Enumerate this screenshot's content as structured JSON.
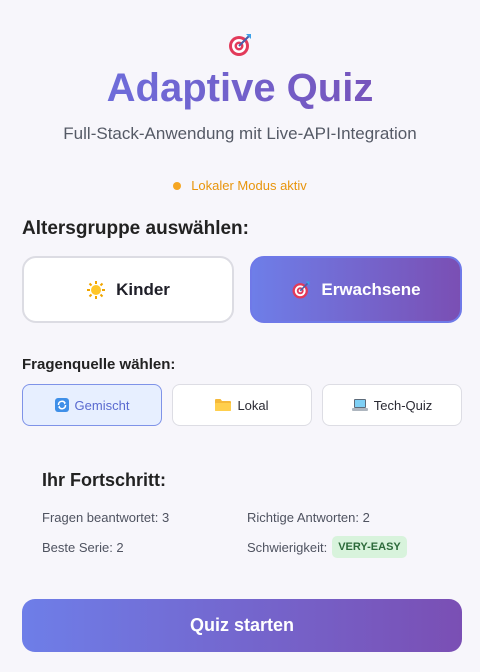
{
  "app": {
    "title": "Adaptive Quiz",
    "subtitle": "Full-Stack-Anwendung mit Live-API-Integration",
    "logo_icon": "target-icon",
    "mode_status": "Lokaler Modus aktiv",
    "mode_status_color": "#f5a623"
  },
  "age_group": {
    "heading": "Altersgruppe auswählen:",
    "options": [
      {
        "label": "Kinder",
        "icon": "sun-icon",
        "selected": false
      },
      {
        "label": "Erwachsene",
        "icon": "target-icon",
        "selected": true
      }
    ]
  },
  "source": {
    "heading": "Fragenquelle wählen:",
    "options": [
      {
        "label": "Gemischt",
        "icon": "shuffle-icon",
        "selected": true
      },
      {
        "label": "Lokal",
        "icon": "folder-icon",
        "selected": false
      },
      {
        "label": "Tech-Quiz",
        "icon": "laptop-icon",
        "selected": false
      }
    ]
  },
  "progress": {
    "heading": "Ihr Fortschritt:",
    "answered": "Fragen beantwortet: 3",
    "correct": "Richtige Antworten: 2",
    "streak": "Beste Serie: 2",
    "difficulty_label": "Schwierigkeit:",
    "difficulty_value": "VERY-EASY"
  },
  "actions": {
    "start_label": "Quiz starten"
  },
  "colors": {
    "accent_start": "#6e7ee8",
    "accent_end": "#7a4fb4",
    "badge_bg": "#d8f3dc"
  }
}
